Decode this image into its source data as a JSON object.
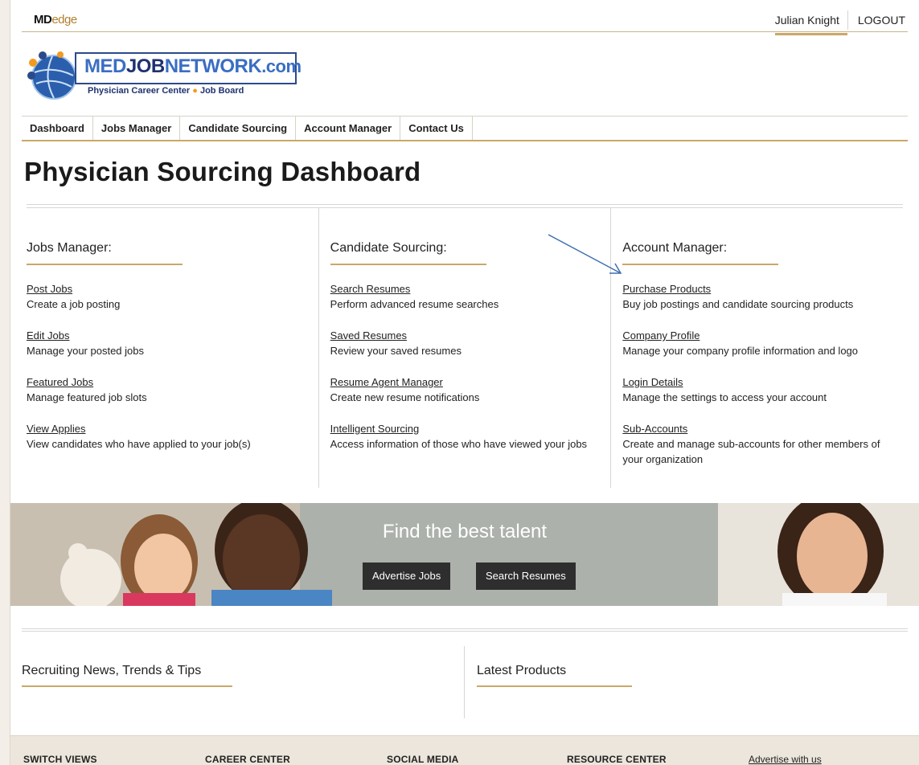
{
  "brand": {
    "md": "MD",
    "edge": "edge"
  },
  "user": {
    "name": "Julian Knight",
    "logout": "LOGOUT"
  },
  "logo": {
    "word_a": "MED",
    "word_b": "JOB",
    "word_c": "NETWORK",
    "dotcom": ".com",
    "tag_left": "Physician Career Center",
    "tag_dot": "●",
    "tag_right": "Job Board"
  },
  "nav": [
    "Dashboard",
    "Jobs Manager",
    "Candidate Sourcing",
    "Account Manager",
    "Contact Us"
  ],
  "page_title": "Physician Sourcing Dashboard",
  "columns": [
    {
      "heading": "Jobs Manager:",
      "items": [
        {
          "link": "Post Jobs",
          "desc": "Create a job posting"
        },
        {
          "link": "Edit Jobs",
          "desc": "Manage your posted jobs"
        },
        {
          "link": "Featured Jobs",
          "desc": "Manage featured job slots"
        },
        {
          "link": "View Applies",
          "desc": "View candidates who have applied to your job(s)"
        }
      ]
    },
    {
      "heading": "Candidate Sourcing:",
      "items": [
        {
          "link": "Search Resumes",
          "desc": "Perform advanced resume searches"
        },
        {
          "link": "Saved Resumes",
          "desc": "Review your saved resumes"
        },
        {
          "link": "Resume Agent Manager",
          "desc": "Create new resume notifications"
        },
        {
          "link": "Intelligent Sourcing",
          "desc": "Access information of those who have viewed your jobs"
        }
      ]
    },
    {
      "heading": "Account Manager:",
      "items": [
        {
          "link": "Purchase Products",
          "desc": "Buy job postings and candidate sourcing products"
        },
        {
          "link": "Company Profile",
          "desc": "Manage your company profile information and logo"
        },
        {
          "link": "Login Details",
          "desc": "Manage the settings to access your account"
        },
        {
          "link": "Sub-Accounts",
          "desc": "Create and manage sub-accounts for other members of your organization"
        }
      ]
    }
  ],
  "banner": {
    "title": "Find the best talent",
    "btn_jobs": "Advertise Jobs",
    "btn_resumes": "Search Resumes"
  },
  "news": {
    "left": "Recruiting News, Trends & Tips",
    "right": "Latest Products"
  },
  "footer": {
    "switch": "SWITCH VIEWS",
    "career": "CAREER CENTER",
    "social": "SOCIAL MEDIA",
    "resource": "RESOURCE CENTER",
    "advertise": "Advertise with us"
  },
  "colors": {
    "accent_gold": "#c9a869",
    "arrow": "#3f6fb0",
    "logo_blue": "#3a6ec3",
    "logo_navy": "#1e3270"
  }
}
